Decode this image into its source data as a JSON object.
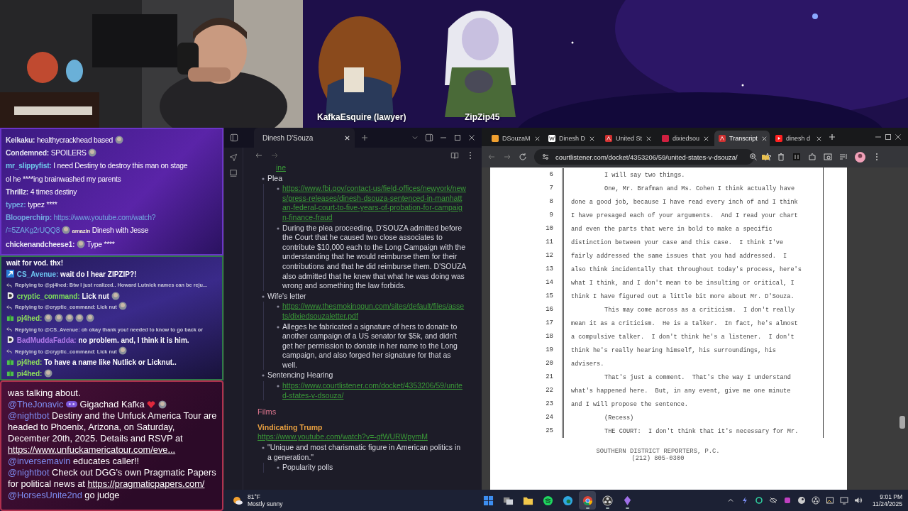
{
  "stream": {
    "name_labels": [
      "KafkaEsquire (lawyer)",
      "ZipZip45"
    ]
  },
  "chat_top": {
    "lines": [
      {
        "segs": [
          {
            "kind": "user",
            "text": "Keikaku:",
            "color": "#e6e6f2"
          },
          {
            "kind": "text",
            "text": "healthycrackhead based"
          },
          {
            "kind": "emote"
          }
        ]
      },
      {
        "segs": [
          {
            "kind": "user",
            "text": "Condemned:",
            "color": "#e6e6f2"
          },
          {
            "kind": "text",
            "text": "SPOILERS"
          },
          {
            "kind": "emote"
          }
        ]
      },
      {
        "segs": [
          {
            "kind": "user",
            "text": "mr_slippyfist:",
            "color": "#6fc8ea"
          },
          {
            "kind": "text",
            "text": "I need Destiny to destroy this man on stage"
          }
        ]
      },
      {
        "segs": [
          {
            "kind": "text",
            "text": "ol he ****ing brainwashed my parents"
          }
        ]
      },
      {
        "segs": [
          {
            "kind": "user",
            "text": "Thrillz:",
            "color": "#e6e6f2"
          },
          {
            "kind": "text",
            "text": "4 times destiny"
          }
        ]
      },
      {
        "segs": [
          {
            "kind": "user",
            "text": "typez:",
            "color": "#72a9e0"
          },
          {
            "kind": "text",
            "text": "typez ****"
          }
        ]
      },
      {
        "segs": [
          {
            "kind": "user",
            "text": "Blooperchirp:",
            "color": "#72a9e0"
          },
          {
            "kind": "url",
            "text": "https://www.youtube.com/watch?"
          }
        ]
      },
      {
        "segs": [
          {
            "kind": "url",
            "text": "/=5ZAKg2rUQQ8"
          },
          {
            "kind": "emote"
          },
          {
            "kind": "tag",
            "text": "amazin"
          },
          {
            "kind": "text",
            "text": "Dinesh with Jesse"
          }
        ]
      },
      {
        "segs": [
          {
            "kind": "user",
            "text": "chickenandcheese1:",
            "color": "#e6e6f2"
          },
          {
            "kind": "emote"
          },
          {
            "kind": "text",
            "text": "Type ****"
          }
        ]
      }
    ]
  },
  "chat_mid": {
    "lines": [
      {
        "kind": "message",
        "segs": [
          {
            "kind": "text",
            "text": "wait for vod. thx!"
          }
        ]
      },
      {
        "kind": "message",
        "segs": [
          {
            "kind": "arrowbadge"
          },
          {
            "kind": "user",
            "text": "CS_Avenue:",
            "color": "#6cc4f0"
          },
          {
            "kind": "text",
            "text": "wait do I hear ZIPZIP?!"
          }
        ]
      },
      {
        "kind": "reply",
        "segs": [
          {
            "kind": "text",
            "text": "Replying to @pj4hed: Btw I just realized.. Howard Lutnick names can be reju..."
          }
        ]
      },
      {
        "kind": "message",
        "segs": [
          {
            "kind": "dbadge"
          },
          {
            "kind": "user",
            "text": "cryptic_command:",
            "color": "#7ee05a"
          },
          {
            "kind": "text",
            "text": "Lick nut"
          },
          {
            "kind": "emote"
          }
        ]
      },
      {
        "kind": "reply",
        "segs": [
          {
            "kind": "text",
            "text": "Replying to @cryptic_command: Lick nut"
          },
          {
            "kind": "emote"
          }
        ]
      },
      {
        "kind": "message",
        "segs": [
          {
            "kind": "giftbadge"
          },
          {
            "kind": "user",
            "text": "pj4hed:",
            "color": "#8fe05a"
          },
          {
            "kind": "emote"
          },
          {
            "kind": "emote"
          },
          {
            "kind": "emote"
          },
          {
            "kind": "emote"
          },
          {
            "kind": "emote"
          }
        ]
      },
      {
        "kind": "reply",
        "segs": [
          {
            "kind": "text",
            "text": "Replying to @CS_Avenue: oh okay thank you! needed to know to go back or"
          }
        ]
      },
      {
        "kind": "message",
        "segs": [
          {
            "kind": "dbadge"
          },
          {
            "kind": "user",
            "text": "BadMuddaFadda:",
            "color": "#b07ae8"
          },
          {
            "kind": "text",
            "text": "no problem. and, I think it is him."
          }
        ]
      },
      {
        "kind": "reply",
        "segs": [
          {
            "kind": "text",
            "text": "Replying to @cryptic_command: Lick nut"
          },
          {
            "kind": "emote"
          }
        ]
      },
      {
        "kind": "message",
        "segs": [
          {
            "kind": "giftbadge"
          },
          {
            "kind": "user",
            "text": "pj4hed:",
            "color": "#8fe05a"
          },
          {
            "kind": "text",
            "text": "To have a name like Nutlick or Licknut.."
          }
        ]
      },
      {
        "kind": "message",
        "segs": [
          {
            "kind": "giftbadge"
          },
          {
            "kind": "user",
            "text": "pi4hed:",
            "color": "#8fe05a"
          },
          {
            "kind": "emote"
          }
        ]
      }
    ]
  },
  "chat_bottom": {
    "lines": [
      {
        "kind": "message",
        "segs": [
          {
            "kind": "text",
            "text": "was talking about."
          }
        ]
      },
      {
        "kind": "message",
        "segs": [
          {
            "kind": "mention",
            "text": "@TheJonavic"
          },
          {
            "kind": "pillbadge"
          },
          {
            "kind": "text",
            "text": "Gigachad Kafka"
          },
          {
            "kind": "heart"
          },
          {
            "kind": "emote"
          }
        ]
      },
      {
        "kind": "paragraph",
        "segs": [
          {
            "kind": "mention",
            "text": "@nightbot"
          },
          {
            "kind": "text",
            "text": "Destiny and the Unfuck America Tour are headed to Phoenix, Arizona, on Saturday, December 20th, 2025. Details and RSVP at"
          },
          {
            "kind": "url",
            "text": "https://www.unfuckamericatour.com/eve..."
          }
        ]
      },
      {
        "kind": "message",
        "segs": [
          {
            "kind": "mention",
            "text": "@inversemavin"
          },
          {
            "kind": "text",
            "text": "educates caller!!"
          }
        ]
      },
      {
        "kind": "paragraph",
        "segs": [
          {
            "kind": "mention",
            "text": "@nightbot"
          },
          {
            "kind": "text",
            "text": "Check out DGG's own Pragmatic Papers for political news at"
          },
          {
            "kind": "url",
            "text": "https://pragmaticpapers.com/"
          }
        ]
      },
      {
        "kind": "message",
        "segs": [
          {
            "kind": "mention",
            "text": "@HorsesUnite2nd"
          },
          {
            "kind": "text",
            "text": "go judge"
          }
        ]
      }
    ]
  },
  "notes": {
    "tab": "Dinesh D'Souza",
    "top_fragment": "ine",
    "outline": [
      {
        "kind": "text",
        "text": "Plea",
        "children": [
          {
            "kind": "link",
            "text": "https://www.fbi.gov/contact-us/field-offices/newyork/news/press-releases/dinesh-dsouza-sentenced-in-manhattan-federal-court-to-five-years-of-probation-for-campaign-finance-fraud"
          },
          {
            "kind": "text",
            "text": "During the plea proceeding, D'SOUZA admitted before the Court that he caused two close associates to contribute $10,000 each to the Long Campaign with the understanding that he would reimburse them for their contributions and that he did reimburse them. D'SOUZA also admitted that he knew that what he was doing was wrong and something the law forbids."
          }
        ]
      },
      {
        "kind": "text",
        "text": "Wife's letter",
        "children": [
          {
            "kind": "link",
            "text": "https://www.thesmokinggun.com/sites/default/files/assets/dixiedsouzaletter.pdf"
          },
          {
            "kind": "text",
            "text": "Alleges he fabricated a signature of hers to donate to another campaign of a US senator for $5k, and didn't get her permission to donate in her name to the Long campaign, and also forged her signature for that as well."
          }
        ]
      },
      {
        "kind": "text",
        "text": "Sentencing Hearing",
        "children": [
          {
            "kind": "link",
            "text": "https://www.courtlistener.com/docket/4353206/59/united-states-v-dsouza/"
          }
        ]
      }
    ],
    "heading": "Films",
    "subheading": "Vindicating Trump",
    "sub_link": "https://www.youtube.com/watch?v=-gfWURWpymM",
    "sub_outline": [
      {
        "kind": "text",
        "text": "\"Unique and most charismatic figure in American politics in a generation.\"",
        "children": [
          {
            "kind": "text",
            "text": "Popularity polls"
          }
        ]
      }
    ]
  },
  "browser": {
    "tabs": [
      {
        "title": "DSouzaM",
        "kind": "peacock",
        "selected": false
      },
      {
        "title": "Dinesh D",
        "kind": "wiki",
        "selected": false
      },
      {
        "title": "United St",
        "kind": "pdf",
        "selected": false
      },
      {
        "title": "dixiedsou",
        "kind": "cbs",
        "selected": false
      },
      {
        "title": "Transcript",
        "kind": "pdf",
        "selected": true
      },
      {
        "title": "dinesh d",
        "kind": "youtube",
        "selected": false
      }
    ],
    "address": "courtlistener.com/docket/4353206/59/united-states-v-dsouza/",
    "transcript": [
      {
        "number": "6",
        "text": "I will say two things.",
        "indented": true
      },
      {
        "number": "7",
        "text": "One, Mr. Brafman and Ms. Cohen I think actually have",
        "indented": true
      },
      {
        "number": "8",
        "text": "done a good job, because I have read every inch of and I think",
        "indented": false
      },
      {
        "number": "9",
        "text": "I have presaged each of your arguments.  And I read your chart",
        "indented": false
      },
      {
        "number": "10",
        "text": "and even the parts that were in bold to make a specific",
        "indented": false
      },
      {
        "number": "11",
        "text": "distinction between your case and this case.  I think I've",
        "indented": false
      },
      {
        "number": "12",
        "text": "fairly addressed the same issues that you had addressed.  I",
        "indented": false
      },
      {
        "number": "13",
        "text": "also think incidentally that throughout today's process, here's",
        "indented": false
      },
      {
        "number": "14",
        "text": "what I think, and I don't mean to be insulting or critical, I",
        "indented": false
      },
      {
        "number": "15",
        "text": "think I have figured out a little bit more about Mr. D'Souza.",
        "indented": false
      },
      {
        "number": "16",
        "text": "This may come across as a criticism.  I don't really",
        "indented": true
      },
      {
        "number": "17",
        "text": "mean it as a criticism.  He is a talker.  In fact, he's almost",
        "indented": false
      },
      {
        "number": "18",
        "text": "a compulsive talker.  I don't think he's a listener.  I don't",
        "indented": false
      },
      {
        "number": "19",
        "text": "think he's really hearing himself, his surroundings, his",
        "indented": false
      },
      {
        "number": "20",
        "text": "advisers.",
        "indented": false
      },
      {
        "number": "21",
        "text": "That's just a comment.  That's the way I understand",
        "indented": true
      },
      {
        "number": "22",
        "text": "what's happened here.  But, in any event, give me one minute",
        "indented": false
      },
      {
        "number": "23",
        "text": "and I will propose the sentence.",
        "indented": false
      },
      {
        "number": "24",
        "text": "(Recess)",
        "indented": true
      },
      {
        "number": "25",
        "text": "THE COURT:  I don't think that it's necessary for Mr.",
        "indented": true
      }
    ],
    "footer": [
      "SOUTHERN DISTRICT REPORTERS, P.C.",
      "(212) 805-0300"
    ]
  },
  "taskbar": {
    "weather": {
      "temperature": "81°F",
      "condition": "Mostly sunny"
    },
    "apps": [
      {
        "kind": "start",
        "active": false,
        "running": false
      },
      {
        "kind": "taskview",
        "active": false,
        "running": false
      },
      {
        "kind": "folder",
        "active": false,
        "running": false
      },
      {
        "kind": "music",
        "active": false,
        "running": false
      },
      {
        "kind": "edge",
        "active": false,
        "running": false
      },
      {
        "kind": "chrome",
        "active": true,
        "running": true
      },
      {
        "kind": "obs",
        "active": false,
        "running": true
      },
      {
        "kind": "crystal",
        "active": false,
        "running": true
      }
    ],
    "time": "9:01 PM",
    "date": "11/24/2025"
  }
}
